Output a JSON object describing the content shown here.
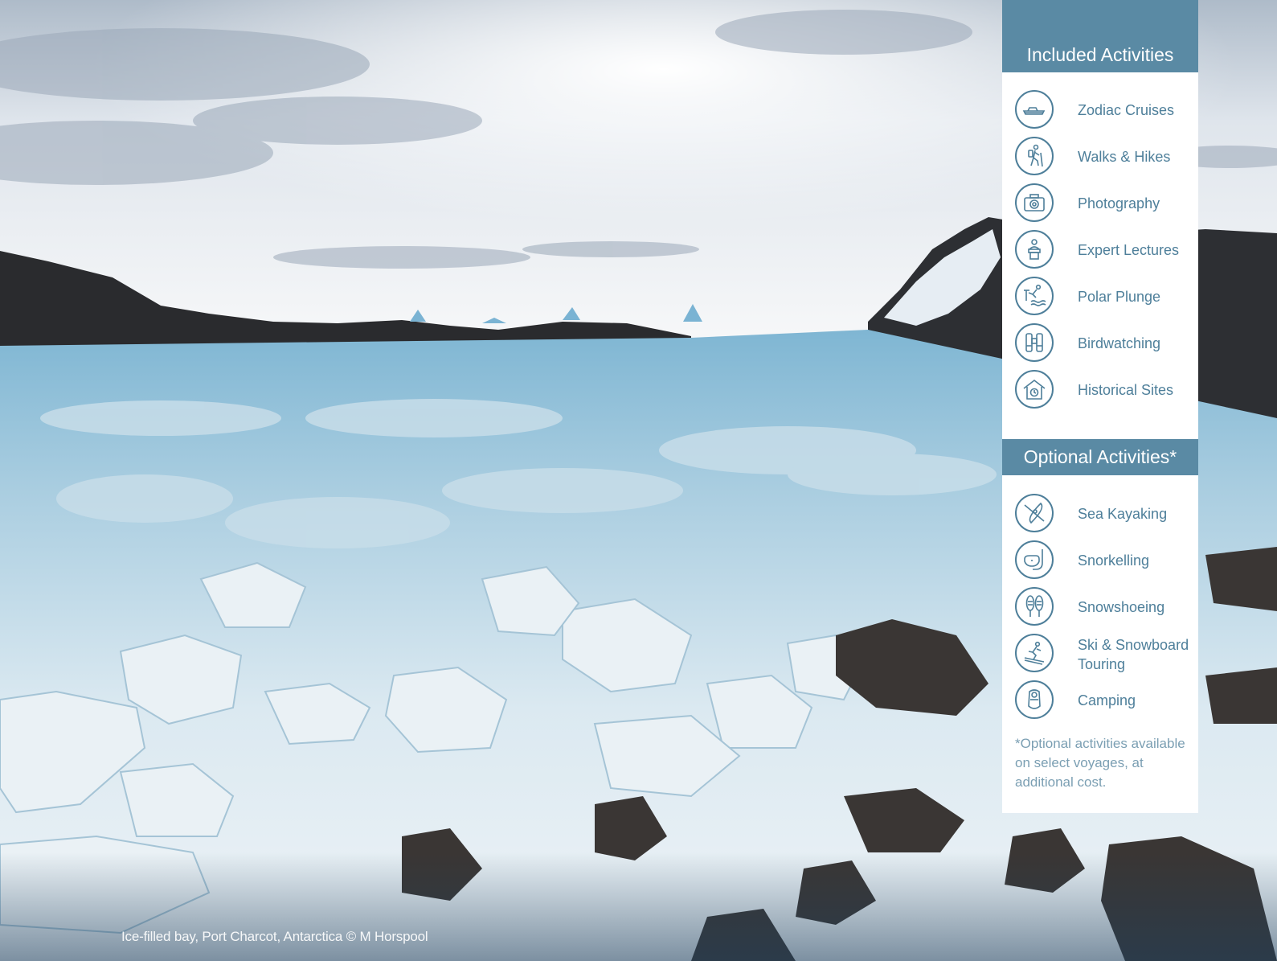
{
  "photo": {
    "description_icon": "antarctic-ice-bay-photo",
    "caption": "Ice-filled bay, Port Charcot, Antarctica © M Horspool"
  },
  "panel": {
    "included_title": "Included Activities",
    "included": [
      {
        "label": "Zodiac Cruises",
        "icon": "zodiac-boat-icon"
      },
      {
        "label": "Walks & Hikes",
        "icon": "hiker-icon"
      },
      {
        "label": "Photography",
        "icon": "camera-icon"
      },
      {
        "label": "Expert Lectures",
        "icon": "lecturer-icon"
      },
      {
        "label": "Polar Plunge",
        "icon": "diver-icon"
      },
      {
        "label": "Birdwatching",
        "icon": "binoculars-icon"
      },
      {
        "label": "Historical Sites",
        "icon": "hut-icon"
      }
    ],
    "optional_title": "Optional Activities*",
    "optional": [
      {
        "label": "Sea Kayaking",
        "icon": "kayak-icon"
      },
      {
        "label": "Snorkelling",
        "icon": "snorkel-mask-icon"
      },
      {
        "label": "Snowshoeing",
        "icon": "snowshoes-icon"
      },
      {
        "label": "Ski & Snowboard Touring",
        "icon": "skier-icon"
      },
      {
        "label": "Camping",
        "icon": "sleeping-bag-icon"
      }
    ],
    "footnote": "*Optional activities available on select voyages, at additional cost."
  },
  "colors": {
    "accent": "#5a8aa4",
    "icon_stroke": "#4e7f9a",
    "footnote": "#7b9fb3"
  }
}
